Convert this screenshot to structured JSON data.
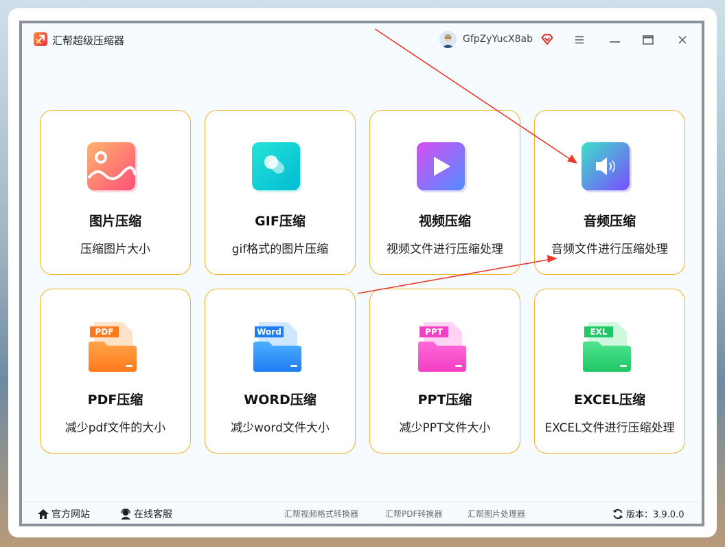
{
  "window": {
    "title": "汇帮超级压缩器",
    "username": "GfpZyYucX8ab"
  },
  "cards": [
    {
      "title": "图片压缩",
      "desc": "压缩图片大小",
      "icon": "image-icon"
    },
    {
      "title": "GIF压缩",
      "desc": "gif格式的图片压缩",
      "icon": "gif-icon"
    },
    {
      "title": "视频压缩",
      "desc": "视频文件进行压缩处理",
      "icon": "video-play-icon"
    },
    {
      "title": "音频压缩",
      "desc": "音频文件进行压缩处理",
      "icon": "speaker-icon"
    },
    {
      "title": "PDF压缩",
      "desc": "减少pdf文件的大小",
      "icon": "pdf-folder-icon",
      "badge": "PDF"
    },
    {
      "title": "WORD压缩",
      "desc": "减少word文件大小",
      "icon": "word-folder-icon",
      "badge": "Word"
    },
    {
      "title": "PPT压缩",
      "desc": "减少PPT文件大小",
      "icon": "ppt-folder-icon",
      "badge": "PPT"
    },
    {
      "title": "EXCEL压缩",
      "desc": "EXCEL文件进行压缩处理",
      "icon": "excel-folder-icon",
      "badge": "EXL"
    }
  ],
  "footer": {
    "website": "官方网站",
    "support": "在线客服",
    "links": [
      "汇帮视频格式转换器",
      "汇帮PDF转换器",
      "汇帮图片处理器"
    ],
    "version": "版本：3.9.0.0"
  },
  "colors": {
    "card_border": "#f2b325",
    "arrow": "#e53a2c"
  }
}
